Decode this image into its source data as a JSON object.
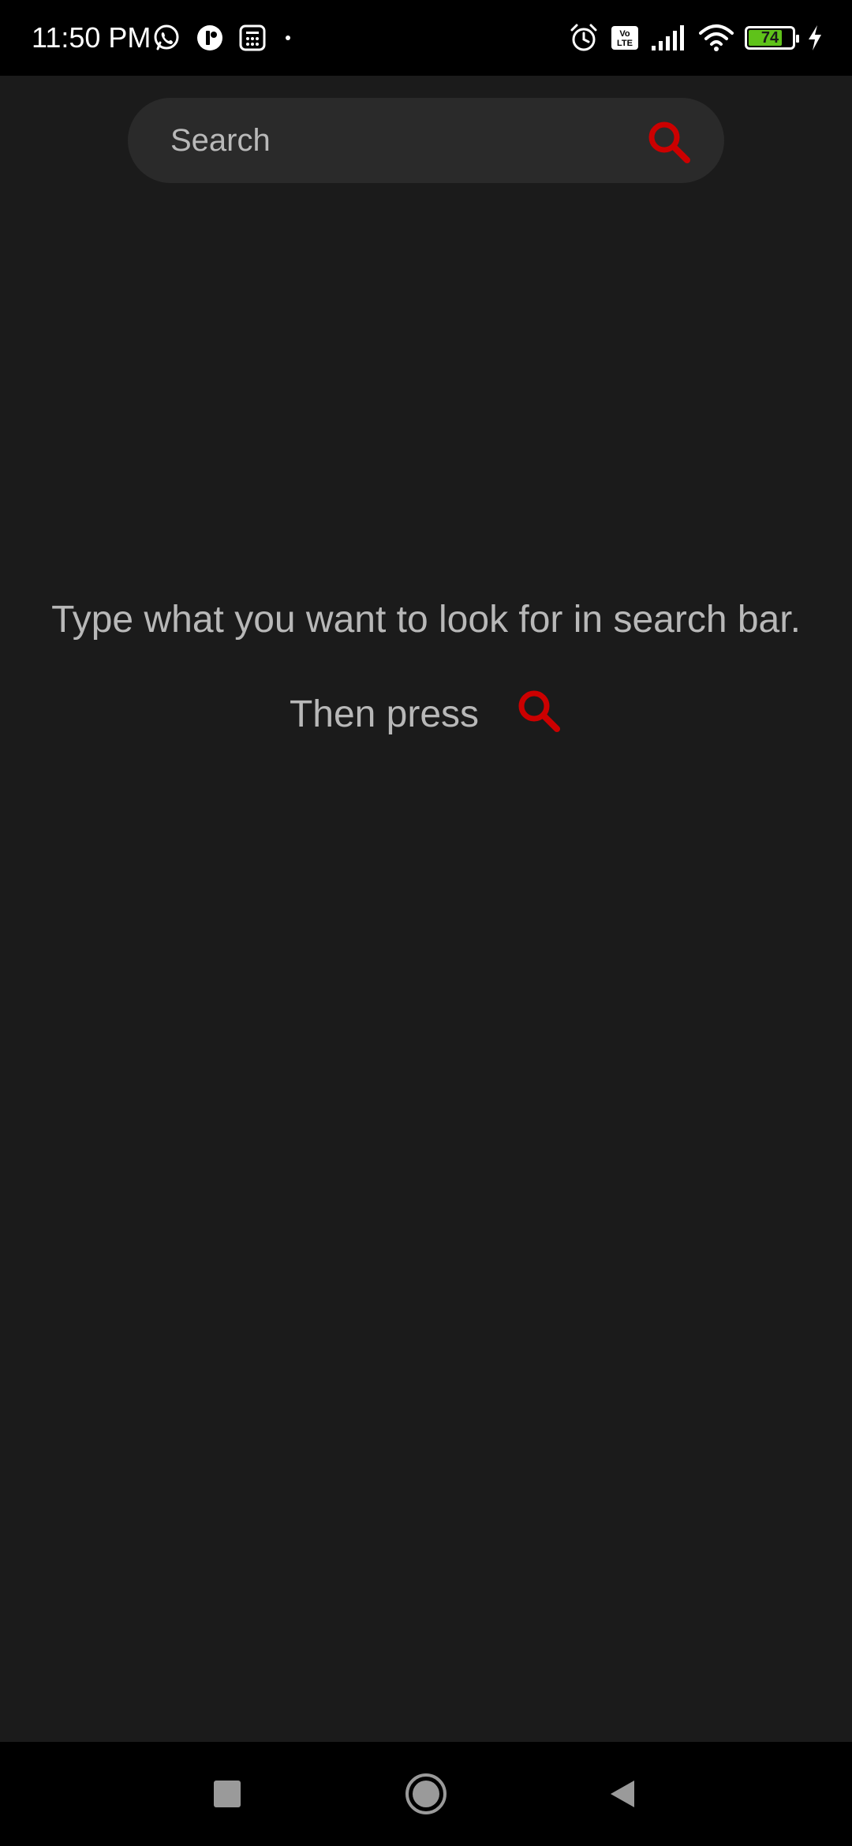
{
  "status_bar": {
    "time": "11:50 PM",
    "left_icons": [
      "whatsapp-icon",
      "app-notification-icon",
      "calculator-icon"
    ],
    "right_icons": [
      "alarm-icon",
      "volte-icon",
      "signal-icon",
      "wifi-icon",
      "battery-icon",
      "charging-icon"
    ],
    "battery_level": "74",
    "battery_color": "#5fc21a"
  },
  "search": {
    "placeholder": "Search",
    "value": "",
    "icon": "search-icon",
    "accent_color": "#cc0000"
  },
  "empty_state": {
    "line1": "Type what you want to look for in search bar.",
    "line2": "Then press",
    "icon": "search-icon"
  },
  "nav_bar": {
    "buttons": [
      "recents-icon",
      "home-icon",
      "back-icon"
    ]
  }
}
